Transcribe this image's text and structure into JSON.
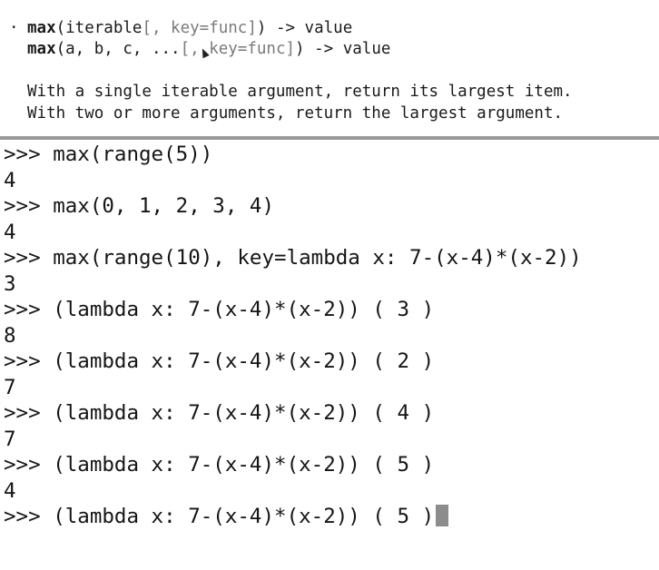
{
  "doc": {
    "bullet": "·",
    "sig1_name": "max",
    "sig1_args": "(iterable",
    "sig1_opt": "[, key=func]",
    "sig1_rest": ") -> value",
    "sig2_name": "max",
    "sig2_args": "(a, b, c, ...",
    "sig2_opt_a": "[,",
    "sig2_opt_b": "key=func]",
    "sig2_rest": ") -> value",
    "desc1": "With a single iterable argument, return its largest item.",
    "desc2": "With two or more arguments, return the largest argument."
  },
  "repl": {
    "prompt": ">>> ",
    "lines": [
      {
        "kind": "input",
        "text": "max(range(5))"
      },
      {
        "kind": "output",
        "text": "4"
      },
      {
        "kind": "input",
        "text": "max(0, 1, 2, 3, 4)"
      },
      {
        "kind": "output",
        "text": "4"
      },
      {
        "kind": "input",
        "text": "max(range(10), key=lambda x: 7-(x-4)*(x-2))"
      },
      {
        "kind": "output",
        "text": "3"
      },
      {
        "kind": "input",
        "text": "(lambda x: 7-(x-4)*(x-2)) ( 3 )"
      },
      {
        "kind": "output",
        "text": "8"
      },
      {
        "kind": "input",
        "text": "(lambda x: 7-(x-4)*(x-2)) ( 2 )"
      },
      {
        "kind": "output",
        "text": "7"
      },
      {
        "kind": "input",
        "text": "(lambda x: 7-(x-4)*(x-2)) ( 4 )"
      },
      {
        "kind": "output",
        "text": "7"
      },
      {
        "kind": "input",
        "text": "(lambda x: 7-(x-4)*(x-2)) ( 5 )"
      },
      {
        "kind": "output",
        "text": "4"
      },
      {
        "kind": "input",
        "text": "(lambda x: 7-(x-4)*(x-2)) ( 5 )"
      }
    ]
  },
  "icons": {
    "mouse_cursor": "mouse-pointer-icon",
    "text_caret": "text-cursor-block"
  },
  "colors": {
    "background": "#ffffff",
    "text": "#151515",
    "dim_text": "#7a7a7a",
    "separator": "#9a9a9a",
    "caret": "#8c8c8c"
  }
}
